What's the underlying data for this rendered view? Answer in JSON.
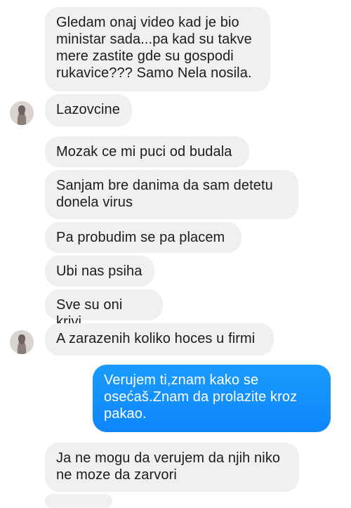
{
  "messages": [
    {
      "id": "m1",
      "direction": "incoming",
      "text": "Gledam onaj video kad je bio\nministar sada...pa kad su takve\nmere zastite gde su gospodi\nrukavice??? Samo Nela nosila."
    },
    {
      "id": "m2",
      "direction": "incoming",
      "text": "Lazovcine"
    },
    {
      "id": "m3",
      "direction": "incoming",
      "text": "Mozak ce mi puci od budala"
    },
    {
      "id": "m4",
      "direction": "incoming",
      "text": "Sanjam bre danima da sam detetu\ndonela virus"
    },
    {
      "id": "m5",
      "direction": "incoming",
      "text": "Pa probudim se pa placem"
    },
    {
      "id": "m6",
      "direction": "incoming",
      "text": "Ubi nas psiha"
    },
    {
      "id": "m7",
      "direction": "incoming",
      "text": "Sve su oni krivi"
    },
    {
      "id": "m8",
      "direction": "incoming",
      "text": "A zarazenih koliko hoces u firmi"
    },
    {
      "id": "m9",
      "direction": "outgoing",
      "text": "Verujem ti,znam kako se\nosećaš.Znam da prolazite kroz\npakao."
    },
    {
      "id": "m10",
      "direction": "incoming",
      "text": "Ja ne mogu da verujem da njih niko\nne moze da zarvori"
    }
  ],
  "colors": {
    "incoming_bubble": "#f0f0f0",
    "outgoing_bubble": "#0f86fb",
    "incoming_text": "#1c1c1c",
    "outgoing_text": "#ffffff"
  },
  "icons": {
    "avatar": "contact-avatar-icon"
  }
}
